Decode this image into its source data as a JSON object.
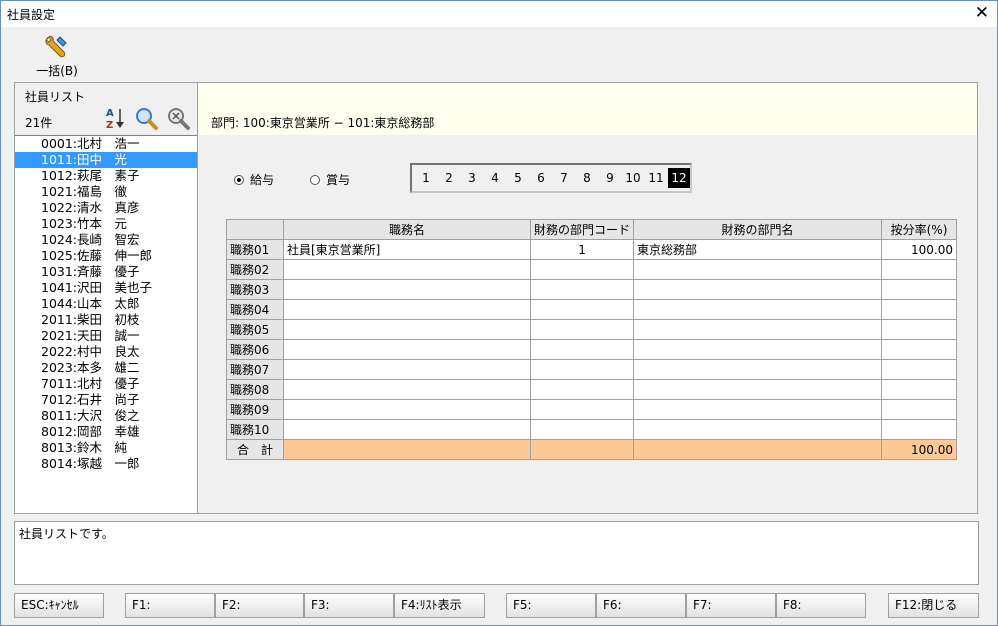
{
  "window": {
    "title": "社員設定",
    "close_glyph": "✕"
  },
  "toolbar": {
    "bulk_label": "一括(B)",
    "bulk_icon": "wrench-icon"
  },
  "employee_panel": {
    "title": "社員リスト",
    "count": "21件",
    "icons": [
      "sort-az-icon",
      "search-icon",
      "search-clear-icon"
    ],
    "items": [
      "0001:北村　浩一",
      "1011:田中　光",
      "1012:萩尾　素子",
      "1021:福島　徹",
      "1022:清水　真彦",
      "1023:竹本　元",
      "1024:長崎　智宏",
      "1025:佐藤　伸一郎",
      "1031:斉藤　優子",
      "1041:沢田　美也子",
      "1044:山本　太郎",
      "2011:柴田　初枝",
      "2021:天田　誠一",
      "2022:村中　良太",
      "2023:本多　雄二",
      "7011:北村　優子",
      "7012:石井　尚子",
      "8011:大沢　俊之",
      "8012:岡部　幸雄",
      "8013:鈴木　純",
      "8014:塚越　一郎"
    ],
    "selected_index": 1
  },
  "dept": {
    "label": "部門:  100:東京営業所 − 101:東京総務部"
  },
  "pay_type": {
    "salary": "給与",
    "bonus": "賞与",
    "selected": "salary"
  },
  "months": {
    "items": [
      "1",
      "2",
      "3",
      "4",
      "5",
      "6",
      "7",
      "8",
      "9",
      "10",
      "11",
      "12"
    ],
    "selected": "12"
  },
  "grid": {
    "headers": [
      "",
      "職務名",
      "財務の部門コード",
      "財務の部門名",
      "按分率(%)"
    ],
    "rows": [
      {
        "label": "職務01",
        "job": "社員[東京営業所]",
        "code": "1",
        "dept": "東京総務部",
        "rate": "100.00"
      },
      {
        "label": "職務02",
        "job": "",
        "code": "",
        "dept": "",
        "rate": ""
      },
      {
        "label": "職務03",
        "job": "",
        "code": "",
        "dept": "",
        "rate": ""
      },
      {
        "label": "職務04",
        "job": "",
        "code": "",
        "dept": "",
        "rate": ""
      },
      {
        "label": "職務05",
        "job": "",
        "code": "",
        "dept": "",
        "rate": ""
      },
      {
        "label": "職務06",
        "job": "",
        "code": "",
        "dept": "",
        "rate": ""
      },
      {
        "label": "職務07",
        "job": "",
        "code": "",
        "dept": "",
        "rate": ""
      },
      {
        "label": "職務08",
        "job": "",
        "code": "",
        "dept": "",
        "rate": ""
      },
      {
        "label": "職務09",
        "job": "",
        "code": "",
        "dept": "",
        "rate": ""
      },
      {
        "label": "職務10",
        "job": "",
        "code": "",
        "dept": "",
        "rate": ""
      }
    ],
    "total": {
      "label": "合　計",
      "rate": "100.00"
    }
  },
  "message": "社員リストです。",
  "fkeys": {
    "esc": "ESC:ｷｬﾝｾﾙ",
    "f1": "F1:",
    "f2": "F2:",
    "f3": "F3:",
    "f4": "F4:ﾘｽﾄ表示",
    "f5": "F5:",
    "f6": "F6:",
    "f7": "F7:",
    "f8": "F8:",
    "f12": "F12:閉じる"
  },
  "colors": {
    "selection": "#3399ff",
    "total_row": "#fcc896",
    "dept_bar": "#fffff0"
  }
}
